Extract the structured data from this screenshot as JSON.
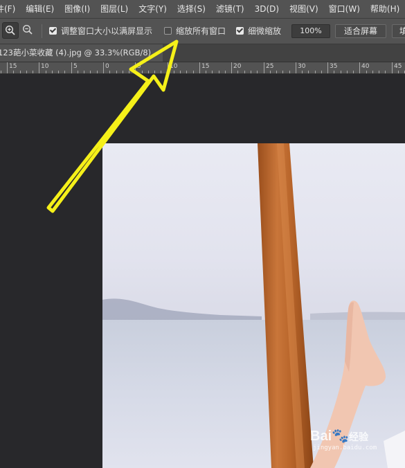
{
  "menu": [
    "件(F)",
    "编辑(E)",
    "图像(I)",
    "图层(L)",
    "文字(Y)",
    "选择(S)",
    "滤镜(T)",
    "3D(D)",
    "视图(V)",
    "窗口(W)",
    "帮助(H)"
  ],
  "options": {
    "resize_windows_label": "调整窗口大小以满屏显示",
    "resize_windows_checked": true,
    "zoom_all_label": "缩放所有窗口",
    "zoom_all_checked": false,
    "scrubby_zoom_label": "细微缩放",
    "scrubby_zoom_checked": true,
    "zoom_value": "100%",
    "fit_screen_label": "适合屏幕",
    "fill_screen_label": "填"
  },
  "document_tab": {
    "title": "123葩小菜收藏 (4).jpg @ 33.3%(RGB/8)"
  },
  "ruler": {
    "labels": [
      "15",
      "10",
      "5",
      "0",
      "5",
      "10",
      "15",
      "20",
      "25",
      "30",
      "35",
      "40",
      "45"
    ]
  },
  "watermark": {
    "brand": "Bai",
    "brand_suffix": "经验",
    "url": "jingyan.baidu.com"
  },
  "colors": {
    "menubar": "#535353",
    "workspace": "#28282b",
    "arrow": "#f5f019"
  }
}
